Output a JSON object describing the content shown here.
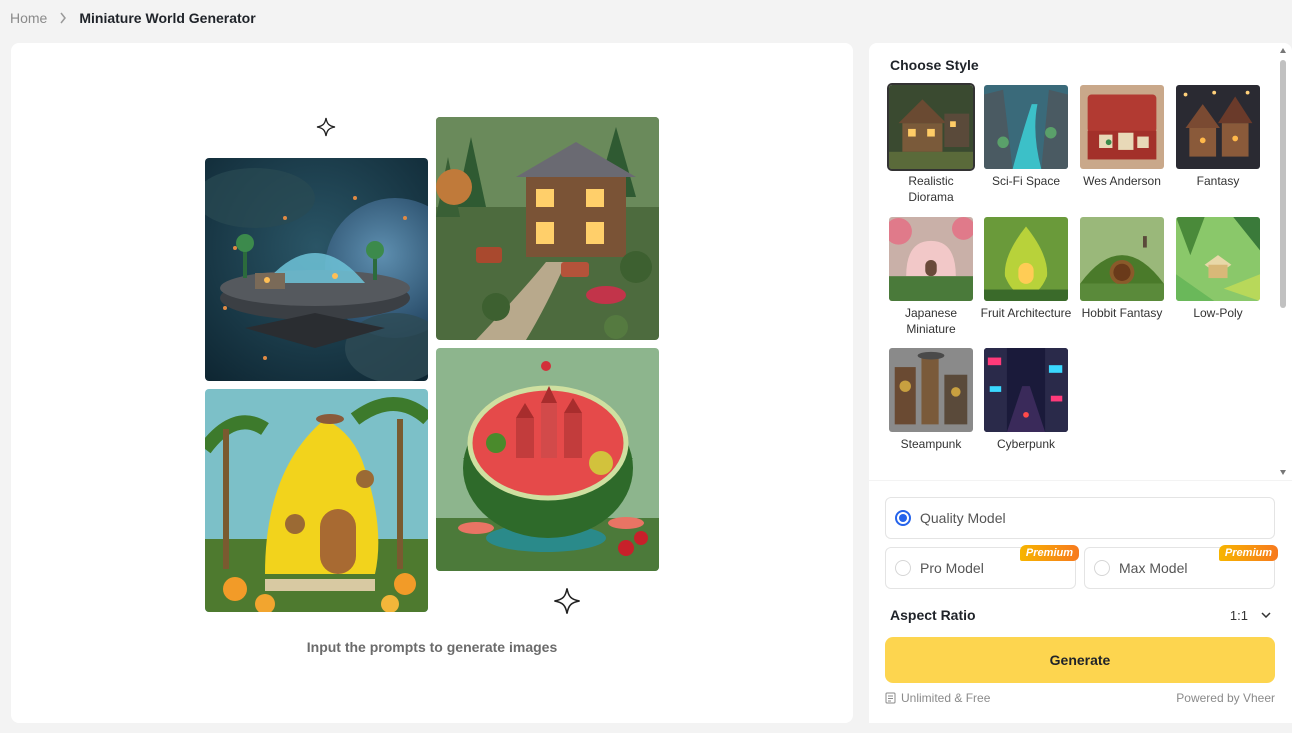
{
  "breadcrumb": {
    "home": "Home",
    "current": "Miniature World Generator"
  },
  "preview": {
    "caption": "Input the prompts to generate images",
    "tiles": [
      "sci-fi-space-station",
      "miniature-house",
      "banana-house",
      "watermelon-city"
    ]
  },
  "styles": {
    "title": "Choose Style",
    "selected": "Realistic Diorama",
    "items": [
      {
        "label": "Realistic Diorama"
      },
      {
        "label": "Sci-Fi Space"
      },
      {
        "label": "Wes Anderson"
      },
      {
        "label": "Fantasy"
      },
      {
        "label": "Japanese Miniature"
      },
      {
        "label": "Fruit Architecture"
      },
      {
        "label": "Hobbit Fantasy"
      },
      {
        "label": "Low-Poly"
      },
      {
        "label": "Steampunk"
      },
      {
        "label": "Cyberpunk"
      }
    ]
  },
  "models": {
    "selected": "Quality Model",
    "quality": {
      "label": "Quality Model"
    },
    "pro": {
      "label": "Pro Model",
      "badge": "Premium"
    },
    "max": {
      "label": "Max Model",
      "badge": "Premium"
    }
  },
  "aspect_ratio": {
    "label": "Aspect Ratio",
    "value": "1:1"
  },
  "generate": {
    "label": "Generate"
  },
  "footer": {
    "left": "Unlimited & Free",
    "right": "Powered by Vheer"
  },
  "colors": {
    "accent": "#fdd54f",
    "radio": "#2563eb",
    "premium": "#f7b500"
  }
}
